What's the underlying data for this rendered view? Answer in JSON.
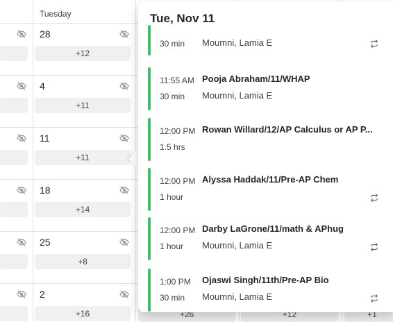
{
  "calendar": {
    "column_header": "Tuesday",
    "rows": [
      {
        "date": "28",
        "more": "+12"
      },
      {
        "date": "4",
        "more": "+11"
      },
      {
        "date": "11",
        "more": "+11"
      },
      {
        "date": "18",
        "more": "+14"
      },
      {
        "date": "25",
        "more": "+8"
      },
      {
        "date": "2",
        "more": "+16"
      }
    ],
    "bottom_overflow": [
      "+26",
      "+12",
      "+1"
    ]
  },
  "popover": {
    "title": "Tue, Nov 11",
    "events": [
      {
        "time": "",
        "duration": "30 min",
        "title": "",
        "organizer": "Moumni, Lamia E",
        "recurring": true
      },
      {
        "time": "11:55 AM",
        "duration": "30 min",
        "title": "Pooja Abraham/11/WHAP",
        "organizer": "Moumni, Lamia E",
        "recurring": false
      },
      {
        "time": "12:00 PM",
        "duration": "1.5 hrs",
        "title": "Rowan Willard/12/AP Calculus or AP P...",
        "organizer": "",
        "recurring": false
      },
      {
        "time": "12:00 PM",
        "duration": "1 hour",
        "title": "Alyssa Haddak/11/Pre-AP Chem",
        "organizer": "",
        "recurring": true
      },
      {
        "time": "12:00 PM",
        "duration": "1 hour",
        "title": "Darby LaGrone/11/math & APhug",
        "organizer": "Moumni, Lamia E",
        "recurring": true
      },
      {
        "time": "1:00 PM",
        "duration": "30 min",
        "title": "Ojaswi Singh/11th/Pre-AP Bio",
        "organizer": "Moumni, Lamia E",
        "recurring": true
      }
    ]
  },
  "icons": {
    "hidden": "eye-off-icon",
    "recurring": "repeat-icon"
  },
  "colors": {
    "event_bar": "#3cc06b",
    "pill": "#f0f0f0",
    "grid": "#e1e1e1"
  }
}
